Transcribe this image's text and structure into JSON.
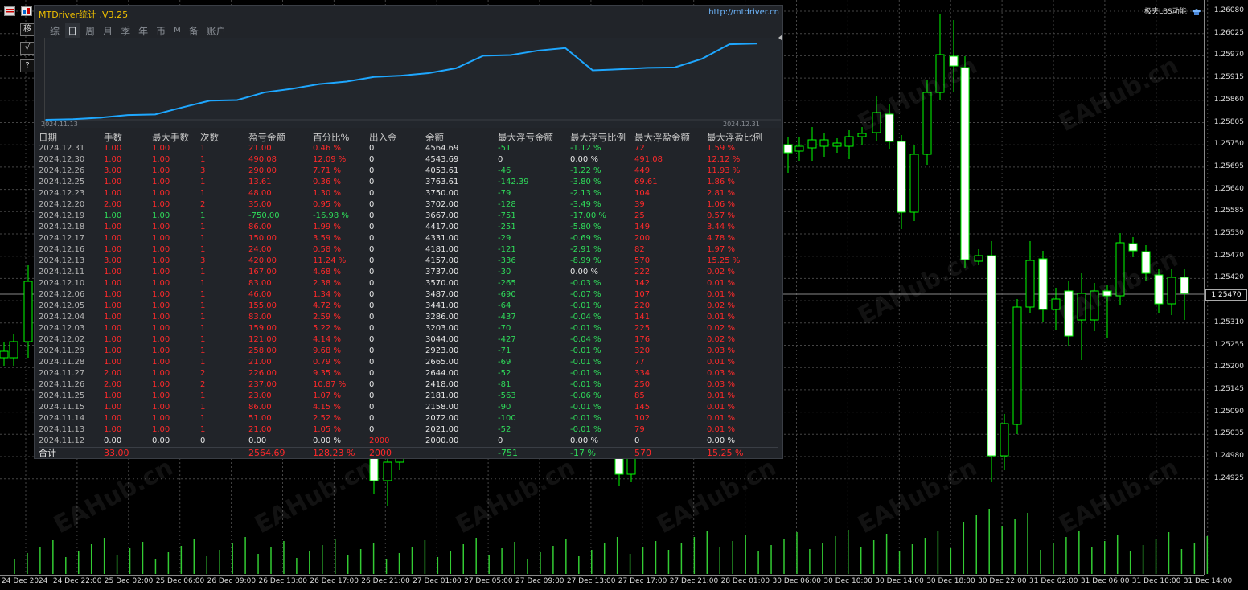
{
  "panel": {
    "title": "MTDriver统计 ,V3.25",
    "url": "http://mtdriver.cn",
    "tabs": [
      "综",
      "日",
      "周",
      "月",
      "季",
      "年",
      "币",
      "M",
      "备",
      "账户"
    ],
    "active_tab": "日",
    "mini_chart_start": "2024.11.13",
    "mini_chart_end": "2024.12.31",
    "line_color": "#1ea7ff"
  },
  "chart_data": {
    "type": "line",
    "x": [
      "2024.11.12",
      "2024.11.13",
      "2024.11.14",
      "2024.11.15",
      "2024.11.25",
      "2024.11.26",
      "2024.11.27",
      "2024.11.28",
      "2024.11.29",
      "2024.12.02",
      "2024.12.03",
      "2024.12.04",
      "2024.12.05",
      "2024.12.06",
      "2024.12.10",
      "2024.12.11",
      "2024.12.13",
      "2024.12.16",
      "2024.12.17",
      "2024.12.18",
      "2024.12.19",
      "2024.12.20",
      "2024.12.23",
      "2024.12.25",
      "2024.12.26",
      "2024.12.30",
      "2024.12.31"
    ],
    "series": [
      {
        "values": [
          2000,
          2021,
          2072,
          2158,
          2181,
          2418,
          2644,
          2665,
          2923,
          3044,
          3203,
          3286,
          3441,
          3487,
          3570,
          3737,
          4157,
          4181,
          4331,
          4417,
          3667,
          3702,
          3750,
          3763.61,
          4053.61,
          4543.69,
          4564.69
        ]
      }
    ],
    "ylim": [
      2000,
      4600
    ]
  },
  "table": {
    "headers": [
      "日期",
      "手数",
      "最大手数",
      "次数",
      "盈亏金额",
      "百分比%",
      "出入金",
      "余额",
      "最大浮亏金额",
      "最大浮亏比例",
      "最大浮盈金额",
      "最大浮盈比例"
    ],
    "rows": [
      {
        "c": [
          "2024.12.31",
          "1.00",
          "1.00",
          "1",
          "21.00",
          "0.46 %",
          "0",
          "4564.69",
          "-51",
          "-1.12 %",
          "72",
          "1.59 %"
        ],
        "t": "red"
      },
      {
        "c": [
          "2024.12.30",
          "1.00",
          "1.00",
          "1",
          "490.08",
          "12.09 %",
          "0",
          "4543.69",
          "0",
          "0.00 %",
          "491.08",
          "12.12 %"
        ],
        "t": "red"
      },
      {
        "c": [
          "2024.12.26",
          "3.00",
          "1.00",
          "3",
          "290.00",
          "7.71 %",
          "0",
          "4053.61",
          "-46",
          "-1.22 %",
          "449",
          "11.93 %"
        ],
        "t": "red"
      },
      {
        "c": [
          "2024.12.25",
          "1.00",
          "1.00",
          "1",
          "13.61",
          "0.36 %",
          "0",
          "3763.61",
          "-142.39",
          "-3.80 %",
          "69.61",
          "1.86 %"
        ],
        "t": "red"
      },
      {
        "c": [
          "2024.12.23",
          "1.00",
          "1.00",
          "1",
          "48.00",
          "1.30 %",
          "0",
          "3750.00",
          "-79",
          "-2.13 %",
          "104",
          "2.81 %"
        ],
        "t": "red"
      },
      {
        "c": [
          "2024.12.20",
          "2.00",
          "1.00",
          "2",
          "35.00",
          "0.95 %",
          "0",
          "3702.00",
          "-128",
          "-3.49 %",
          "39",
          "1.06 %"
        ],
        "t": "red"
      },
      {
        "c": [
          "2024.12.19",
          "1.00",
          "1.00",
          "1",
          "-750.00",
          "-16.98 %",
          "0",
          "3667.00",
          "-751",
          "-17.00 %",
          "25",
          "0.57 %"
        ],
        "t": "green"
      },
      {
        "c": [
          "2024.12.18",
          "1.00",
          "1.00",
          "1",
          "86.00",
          "1.99 %",
          "0",
          "4417.00",
          "-251",
          "-5.80 %",
          "149",
          "3.44 %"
        ],
        "t": "red"
      },
      {
        "c": [
          "2024.12.17",
          "1.00",
          "1.00",
          "1",
          "150.00",
          "3.59 %",
          "0",
          "4331.00",
          "-29",
          "-0.69 %",
          "200",
          "4.78 %"
        ],
        "t": "red"
      },
      {
        "c": [
          "2024.12.16",
          "1.00",
          "1.00",
          "1",
          "24.00",
          "0.58 %",
          "0",
          "4181.00",
          "-121",
          "-2.91 %",
          "82",
          "1.97 %"
        ],
        "t": "red"
      },
      {
        "c": [
          "2024.12.13",
          "3.00",
          "1.00",
          "3",
          "420.00",
          "11.24 %",
          "0",
          "4157.00",
          "-336",
          "-8.99 %",
          "570",
          "15.25 %"
        ],
        "t": "red"
      },
      {
        "c": [
          "2024.12.11",
          "1.00",
          "1.00",
          "1",
          "167.00",
          "4.68 %",
          "0",
          "3737.00",
          "-30",
          "0.00 %",
          "222",
          "0.02 %"
        ],
        "t": "red"
      },
      {
        "c": [
          "2024.12.10",
          "1.00",
          "1.00",
          "1",
          "83.00",
          "2.38 %",
          "0",
          "3570.00",
          "-265",
          "-0.03 %",
          "142",
          "0.01 %"
        ],
        "t": "red"
      },
      {
        "c": [
          "2024.12.06",
          "1.00",
          "1.00",
          "1",
          "46.00",
          "1.34 %",
          "0",
          "3487.00",
          "-690",
          "-0.07 %",
          "107",
          "0.01 %"
        ],
        "t": "red"
      },
      {
        "c": [
          "2024.12.05",
          "1.00",
          "1.00",
          "1",
          "155.00",
          "4.72 %",
          "0",
          "3441.00",
          "-64",
          "-0.01 %",
          "220",
          "0.02 %"
        ],
        "t": "red"
      },
      {
        "c": [
          "2024.12.04",
          "1.00",
          "1.00",
          "1",
          "83.00",
          "2.59 %",
          "0",
          "3286.00",
          "-437",
          "-0.04 %",
          "141",
          "0.01 %"
        ],
        "t": "red"
      },
      {
        "c": [
          "2024.12.03",
          "1.00",
          "1.00",
          "1",
          "159.00",
          "5.22 %",
          "0",
          "3203.00",
          "-70",
          "-0.01 %",
          "225",
          "0.02 %"
        ],
        "t": "red"
      },
      {
        "c": [
          "2024.12.02",
          "1.00",
          "1.00",
          "1",
          "121.00",
          "4.14 %",
          "0",
          "3044.00",
          "-427",
          "-0.04 %",
          "176",
          "0.02 %"
        ],
        "t": "red"
      },
      {
        "c": [
          "2024.11.29",
          "1.00",
          "1.00",
          "1",
          "258.00",
          "9.68 %",
          "0",
          "2923.00",
          "-71",
          "-0.01 %",
          "320",
          "0.03 %"
        ],
        "t": "red"
      },
      {
        "c": [
          "2024.11.28",
          "1.00",
          "1.00",
          "1",
          "21.00",
          "0.79 %",
          "0",
          "2665.00",
          "-69",
          "-0.01 %",
          "77",
          "0.01 %"
        ],
        "t": "red"
      },
      {
        "c": [
          "2024.11.27",
          "2.00",
          "1.00",
          "2",
          "226.00",
          "9.35 %",
          "0",
          "2644.00",
          "-52",
          "-0.01 %",
          "334",
          "0.03 %"
        ],
        "t": "red"
      },
      {
        "c": [
          "2024.11.26",
          "2.00",
          "1.00",
          "2",
          "237.00",
          "10.87 %",
          "0",
          "2418.00",
          "-81",
          "-0.01 %",
          "250",
          "0.03 %"
        ],
        "t": "red"
      },
      {
        "c": [
          "2024.11.25",
          "1.00",
          "1.00",
          "1",
          "23.00",
          "1.07 %",
          "0",
          "2181.00",
          "-563",
          "-0.06 %",
          "85",
          "0.01 %"
        ],
        "t": "red"
      },
      {
        "c": [
          "2024.11.15",
          "1.00",
          "1.00",
          "1",
          "86.00",
          "4.15 %",
          "0",
          "2158.00",
          "-90",
          "-0.01 %",
          "145",
          "0.01 %"
        ],
        "t": "red"
      },
      {
        "c": [
          "2024.11.14",
          "1.00",
          "1.00",
          "1",
          "51.00",
          "2.52 %",
          "0",
          "2072.00",
          "-100",
          "-0.01 %",
          "102",
          "0.01 %"
        ],
        "t": "red"
      },
      {
        "c": [
          "2024.11.13",
          "1.00",
          "1.00",
          "1",
          "21.00",
          "1.05 %",
          "0",
          "2021.00",
          "-52",
          "-0.01 %",
          "79",
          "0.01 %"
        ],
        "t": "red"
      },
      {
        "c": [
          "2024.11.12",
          "0.00",
          "0.00",
          "0",
          "0.00",
          "0.00 %",
          "2000",
          "2000.00",
          "0",
          "0.00 %",
          "0",
          "0.00 %"
        ],
        "t": "zero"
      }
    ],
    "summary": {
      "label": "合计",
      "lots": "33.00",
      "pnl": "2564.69",
      "pct": "128.23 %",
      "deposit": "2000",
      "max_dd": "-751",
      "max_dd_pct": "-17 %",
      "max_fp": "570",
      "max_fp_pct": "15.25 %"
    }
  },
  "price_axis": [
    "1.26080",
    "1.26025",
    "1.25970",
    "1.25915",
    "1.25860",
    "1.25805",
    "1.25750",
    "1.25695",
    "1.25640",
    "1.25585",
    "1.25530",
    "1.25470",
    "1.25420",
    "1.25365",
    "1.25310",
    "1.25255",
    "1.25200",
    "1.25145",
    "1.25090",
    "1.25035",
    "1.24980",
    "1.24925"
  ],
  "current_price": "1.25470",
  "time_axis": [
    "24 Dec 2024",
    "24 Dec 22:00",
    "25 Dec 02:00",
    "25 Dec 06:00",
    "26 Dec 09:00",
    "26 Dec 13:00",
    "26 Dec 17:00",
    "26 Dec 21:00",
    "27 Dec 01:00",
    "27 Dec 05:00",
    "27 Dec 09:00",
    "27 Dec 13:00",
    "27 Dec 17:00",
    "27 Dec 21:00",
    "28 Dec 01:00",
    "30 Dec 06:00",
    "30 Dec 10:00",
    "30 Dec 14:00",
    "30 Dec 18:00",
    "30 Dec 22:00",
    "31 Dec 02:00",
    "31 Dec 06:00",
    "31 Dec 10:00",
    "31 Dec 14:00"
  ],
  "broker": "极夹LBS动能",
  "toolbar": {
    "move": "移",
    "check": "√",
    "help": "?"
  },
  "watermark": "EAHub.cn",
  "colors": {
    "up_candle": "#ffffff",
    "down_candle": "#00ff00",
    "volume": "#33cc33",
    "grid": "#444"
  }
}
